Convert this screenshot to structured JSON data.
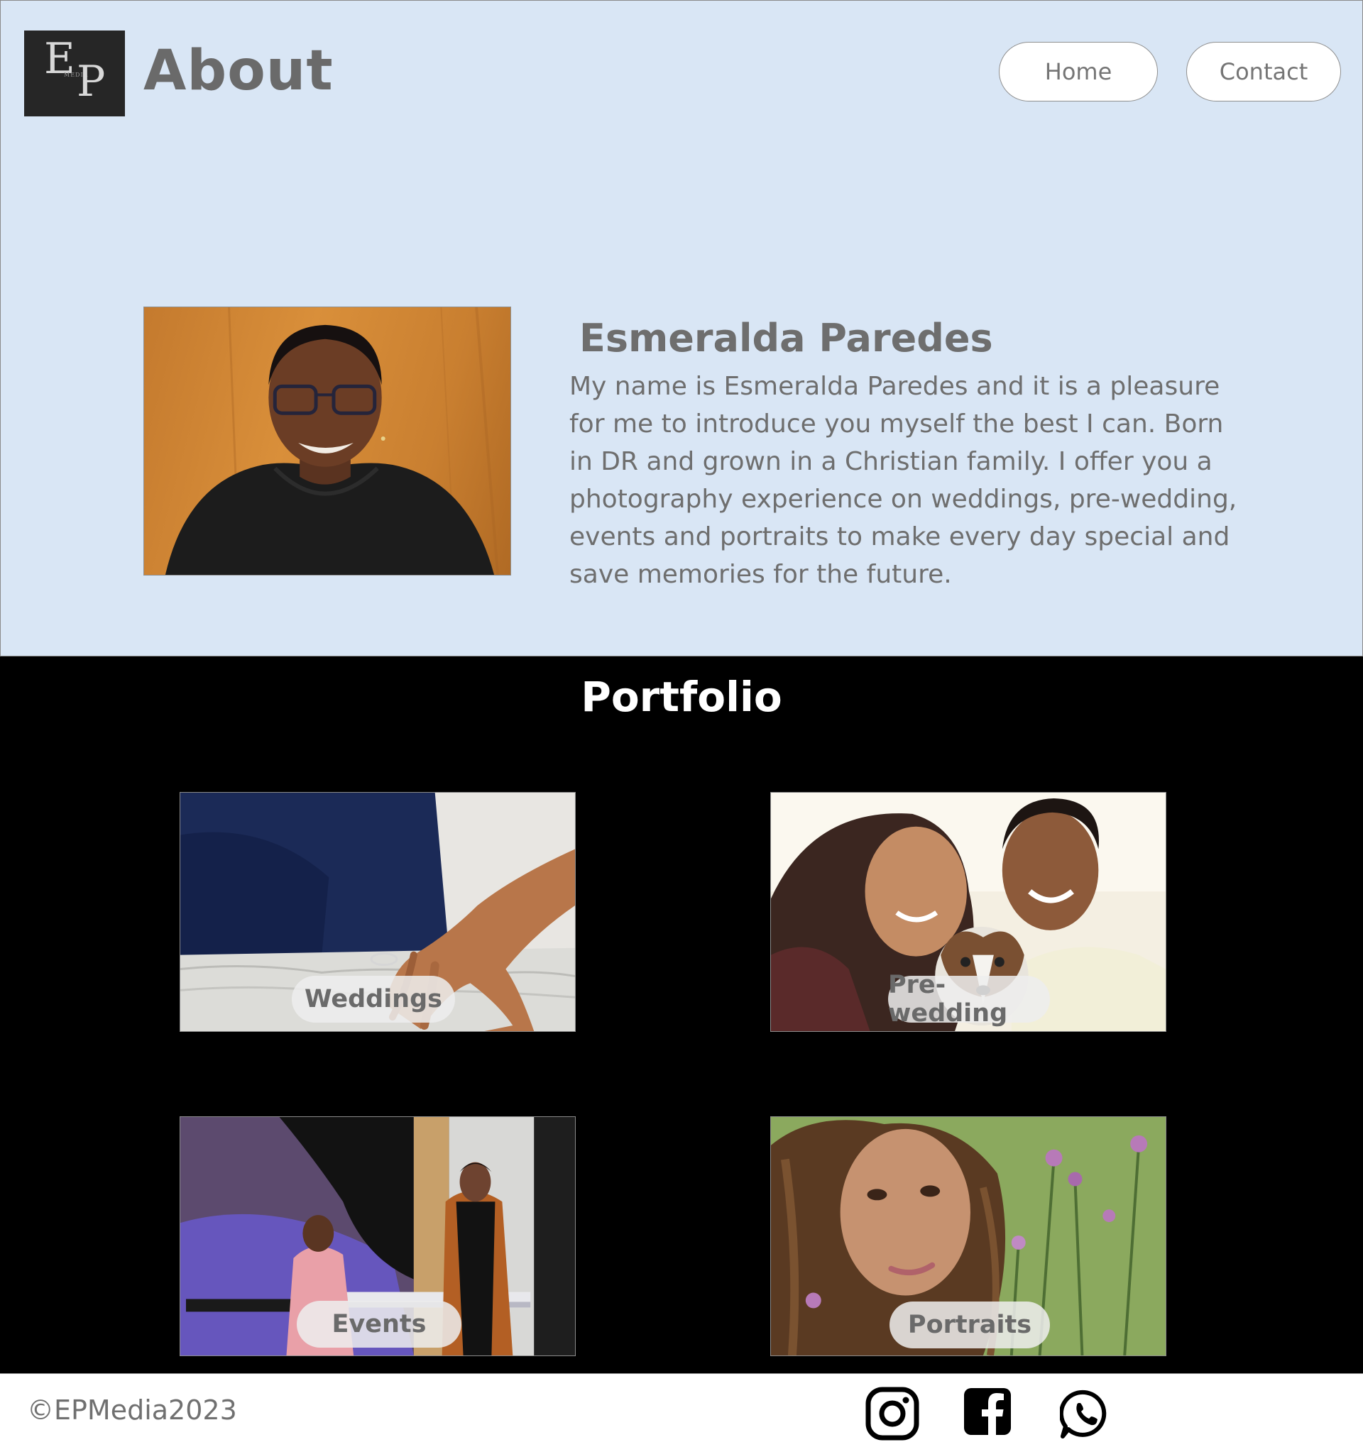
{
  "header": {
    "logo": {
      "letters": "EP",
      "tagline": "MEDIA"
    },
    "title": "About",
    "nav": [
      {
        "label": "Home"
      },
      {
        "label": "Contact"
      }
    ]
  },
  "profile": {
    "name": "Esmeralda Paredes",
    "bio": "My name is Esmeralda Paredes and it is a pleasure for me to introduce you myself the best I can. Born in DR and grown in a Christian family. I offer you a photography experience on weddings, pre-wedding, events and portraits to make every day special and save memories for the future."
  },
  "portfolio": {
    "title": "Portfolio",
    "cards": [
      {
        "label": "Weddings"
      },
      {
        "label": "Pre-wedding"
      },
      {
        "label": "Events"
      },
      {
        "label": "Portraits"
      }
    ]
  },
  "footer": {
    "copyright": "©EPMedia2023",
    "social": [
      "instagram-icon",
      "facebook-icon",
      "whatsapp-icon"
    ]
  },
  "colors": {
    "about_bg": "#d9e6f5",
    "portfolio_bg": "#000000",
    "text_gray": "#6e6e6e",
    "logo_bg": "#262626"
  }
}
